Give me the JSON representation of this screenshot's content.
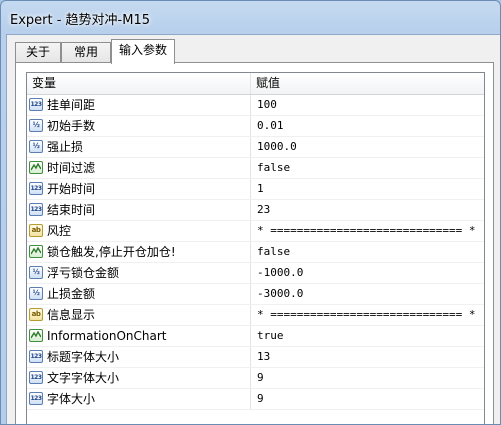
{
  "window": {
    "title": "Expert - 趋势对冲-M15"
  },
  "tabs": [
    {
      "label": "关于"
    },
    {
      "label": "常用"
    },
    {
      "label": "输入参数"
    }
  ],
  "table": {
    "headers": {
      "variable": "变量",
      "value": "赋值"
    },
    "rows": [
      {
        "icon": "int-icon",
        "name": "挂单间距",
        "value": "100"
      },
      {
        "icon": "double-icon",
        "name": "初始手数",
        "value": "0.01"
      },
      {
        "icon": "double-icon",
        "name": "强止损",
        "value": "1000.0"
      },
      {
        "icon": "bool-icon",
        "name": "时间过滤",
        "value": "false"
      },
      {
        "icon": "int-icon",
        "name": "开始时间",
        "value": "1"
      },
      {
        "icon": "int-icon",
        "name": "结束时间",
        "value": "23"
      },
      {
        "icon": "string-icon",
        "name": "风控",
        "value": "* ============================= *"
      },
      {
        "icon": "bool-icon",
        "name": "锁仓触发,停止开仓加仓!",
        "value": "false"
      },
      {
        "icon": "double-icon",
        "name": "浮亏锁仓金额",
        "value": "-1000.0"
      },
      {
        "icon": "double-icon",
        "name": "止损金额",
        "value": "-3000.0"
      },
      {
        "icon": "string-icon",
        "name": "信息显示",
        "value": "* ============================= *"
      },
      {
        "icon": "bool-icon",
        "name": "InformationOnChart",
        "value": "true"
      },
      {
        "icon": "int-icon",
        "name": "标题字体大小",
        "value": "13"
      },
      {
        "icon": "int-icon",
        "name": "文字字体大小",
        "value": "9"
      },
      {
        "icon": "int-icon",
        "name": "字体大小",
        "value": "9"
      }
    ]
  },
  "icon_glyphs": {
    "int-icon": "123",
    "double-icon": "½",
    "string-icon": "ab"
  }
}
